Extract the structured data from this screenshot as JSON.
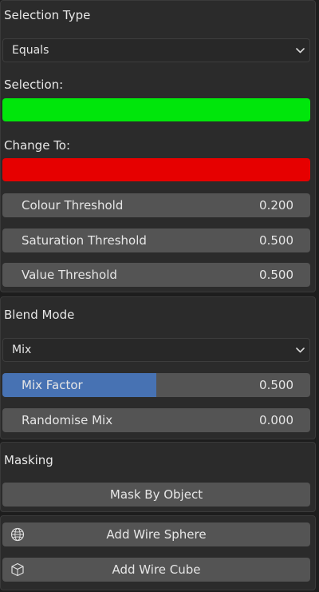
{
  "selection_type": {
    "label": "Selection Type",
    "dropdown_value": "Equals"
  },
  "selection": {
    "label": "Selection:",
    "color": "#00e60b"
  },
  "change_to": {
    "label": "Change To:",
    "color": "#e60000"
  },
  "thresholds": [
    {
      "label": "Colour Threshold",
      "value": "0.200"
    },
    {
      "label": "Saturation Threshold",
      "value": "0.500"
    },
    {
      "label": "Value Threshold",
      "value": "0.500"
    }
  ],
  "blend": {
    "label": "Blend Mode",
    "dropdown_value": "Mix",
    "mix_factor": {
      "label": "Mix Factor",
      "value": "0.500",
      "fraction": 0.5
    },
    "randomise_mix": {
      "label": "Randomise Mix",
      "value": "0.000"
    }
  },
  "masking": {
    "label": "Masking",
    "mask_button": "Mask By Object"
  },
  "wire": {
    "sphere": {
      "label": "Add Wire Sphere",
      "icon": "sphere-icon"
    },
    "cube": {
      "label": "Add Wire Cube",
      "icon": "cube-icon"
    }
  },
  "colors": {
    "accent": "#4772b3",
    "panel": "#2b2b2b",
    "field": "#545454"
  }
}
